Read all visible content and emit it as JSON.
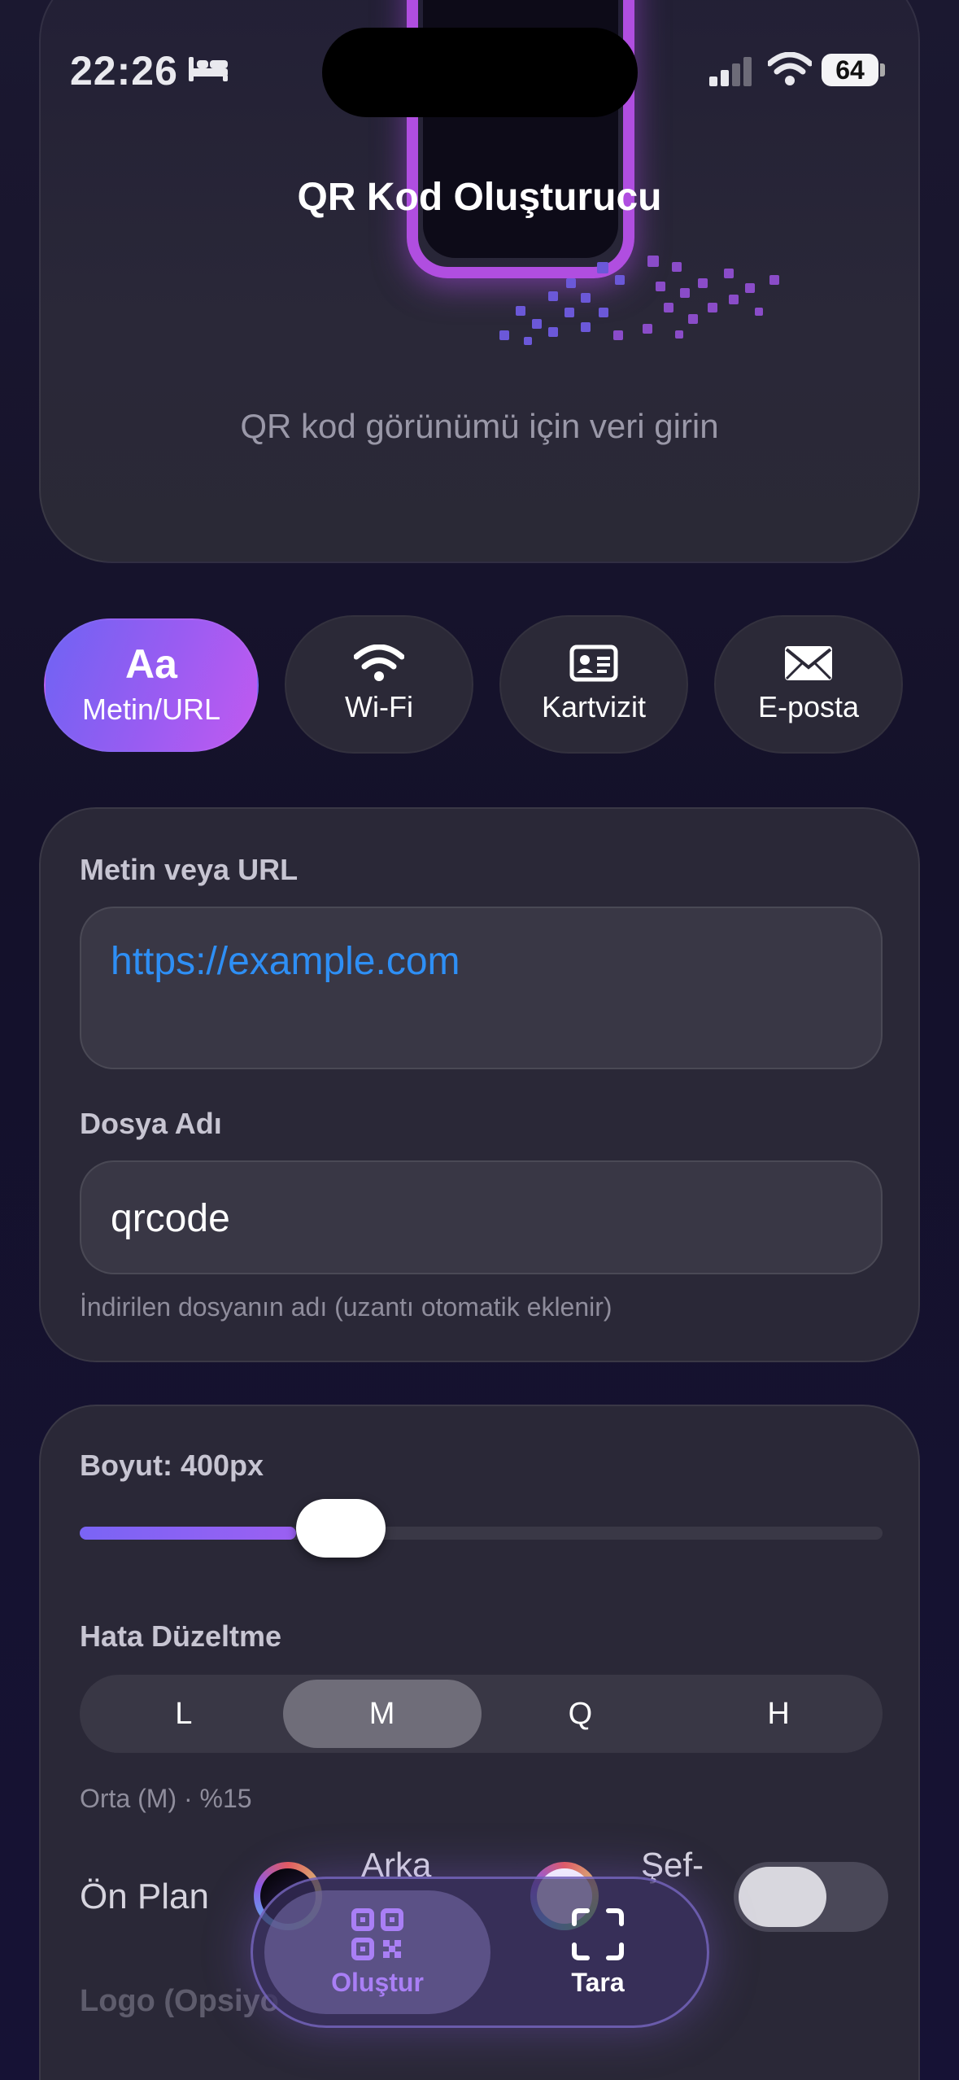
{
  "status": {
    "time": "22:26",
    "battery": "64"
  },
  "header": {
    "title": "QR Kod Oluşturucu",
    "hint": "QR kod görünümü için veri girin"
  },
  "types": [
    {
      "label": "Metin/URL",
      "glyph": "Aa",
      "icon": "text-icon",
      "active": true
    },
    {
      "label": "Wi-Fi",
      "icon": "wifi-icon",
      "active": false
    },
    {
      "label": "Kartvizit",
      "icon": "contact-card-icon",
      "active": false
    },
    {
      "label": "E-posta",
      "icon": "envelope-icon",
      "active": false
    }
  ],
  "content": {
    "text_label": "Metin veya URL",
    "text_value": "https://example.com",
    "filename_label": "Dosya Adı",
    "filename_value": "qrcode",
    "filename_helper": "İndirilen dosyanın adı (uzantı otomatik eklenir)"
  },
  "settings": {
    "size_label": "Boyut: 400px",
    "size_fraction": 0.27,
    "ecc_label": "Hata Düzeltme",
    "ecc_options": [
      "L",
      "M",
      "Q",
      "H"
    ],
    "ecc_selected": "M",
    "ecc_hint": "Orta (M) · %15",
    "foreground_label": "Ön Plan",
    "background_label": "Arka",
    "transparent_label": "Şef-",
    "logo_label": "Logo (Opsiyo"
  },
  "nav": {
    "create": "Oluştur",
    "scan": "Tara"
  },
  "colors": {
    "accent": "#9a5cf2",
    "link": "#2e8ff5"
  }
}
